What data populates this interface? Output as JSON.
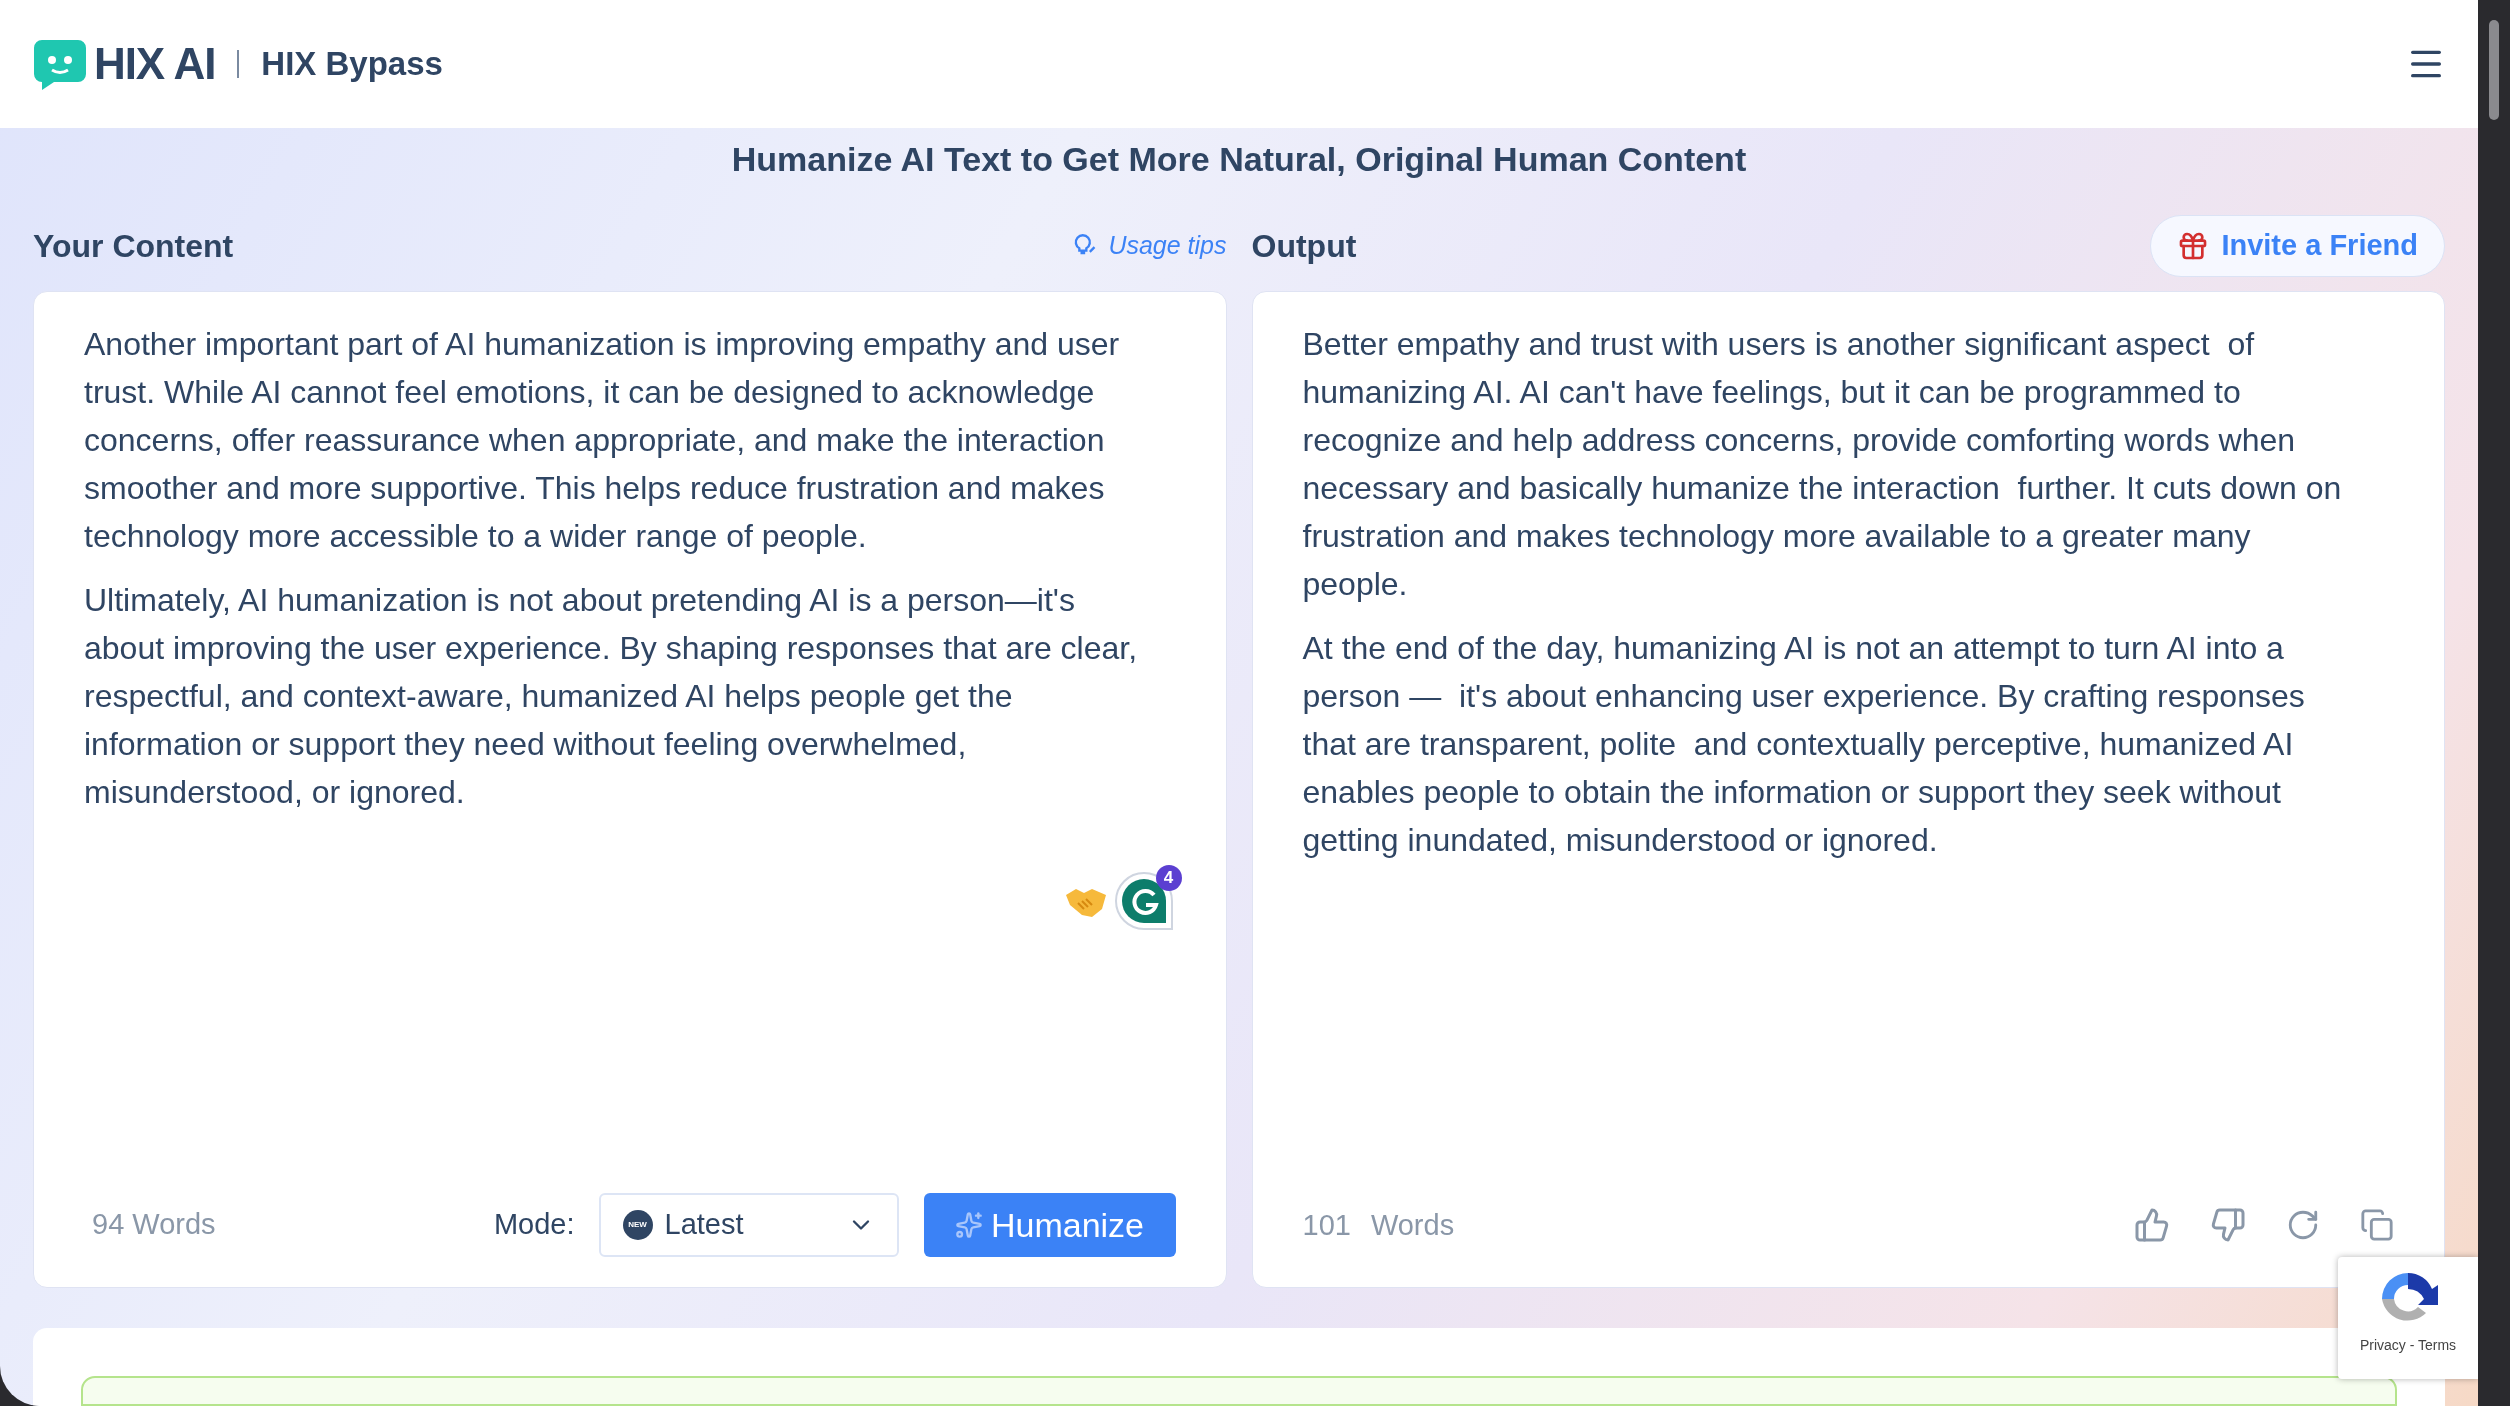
{
  "header": {
    "logo_text": "HIX AI",
    "product": "HIX Bypass"
  },
  "heading": "Humanize AI Text to Get More Natural, Original Human Content",
  "input": {
    "label": "Your Content",
    "tips": "Usage tips",
    "paragraphs": [
      "Another important part of AI humanization is improving empathy and user trust. While AI cannot feel emotions, it can be designed to acknowledge concerns, offer reassurance when appropriate, and make the interaction smoother and more supportive. This helps reduce frustration and makes technology more accessible to a wider range of people.",
      "Ultimately, AI humanization is not about pretending AI is a person—it's about improving the user experience. By shaping responses that are clear, respectful, and context-aware, humanized AI helps people get the information or support they need without feeling overwhelmed, misunderstood, or ignored."
    ],
    "grammar_badge": "4",
    "word_count": "94 Words",
    "mode_label": "Mode:",
    "mode_badge": "NEW",
    "mode_value": "Latest",
    "button": "Humanize"
  },
  "output": {
    "label": "Output",
    "invite": "Invite a Friend",
    "paragraphs": [
      "Better empathy and trust with users is another significant aspect  of humanizing AI. AI can't have feelings, but it can be programmed to recognize and help address concerns, provide comforting words when necessary and basically humanize the interaction  further. It cuts down on frustration and makes technology more available to a greater many people.",
      "At the end of the day, humanizing AI is not an attempt to turn AI into a person —  it's about enhancing user experience. By crafting responses that are transparent, polite  and contextually perceptive, humanized AI enables people to obtain the information or support they seek without getting inundated, misunderstood or ignored."
    ],
    "word_number": "101",
    "word_unit": "Words"
  },
  "recaptcha": {
    "links": "Privacy - Terms"
  }
}
